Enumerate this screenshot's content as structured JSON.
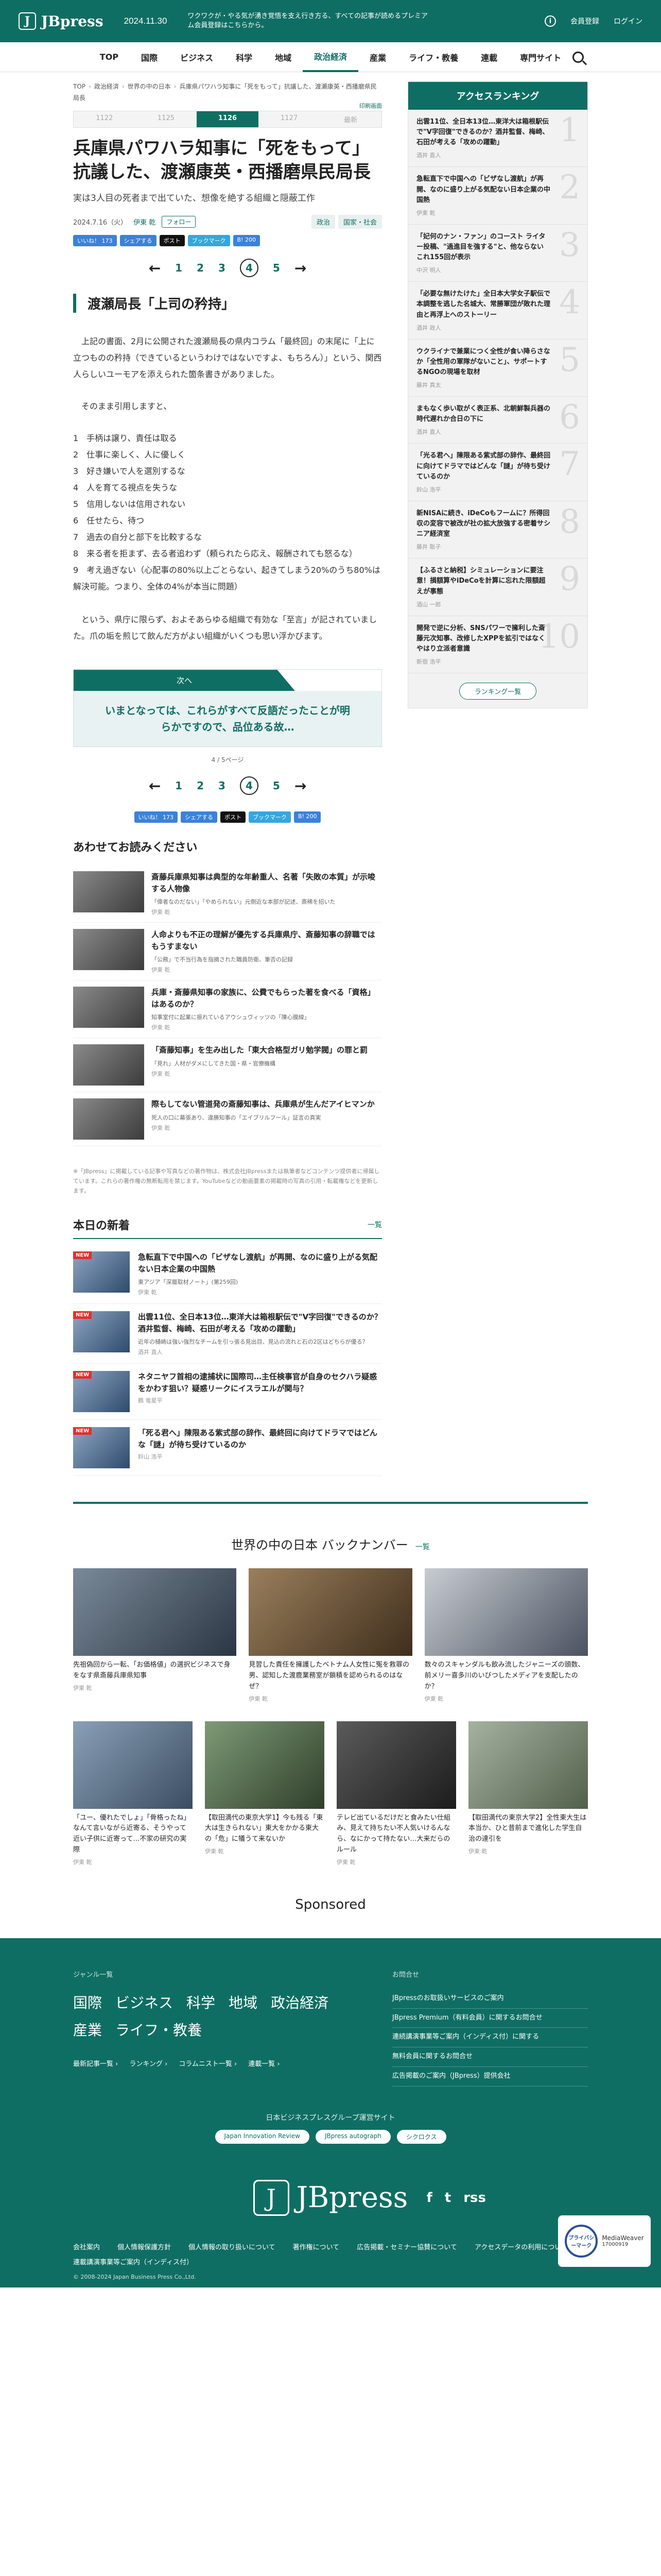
{
  "header": {
    "logo": "JBpress",
    "date": "2024.11.30",
    "message": "ワクワクが・やる気が湧き覚悟を支え行き方る、すべての記事が読めるプレミアム会員登録はこちらから。",
    "member": "会員登録",
    "login": "ログイン"
  },
  "nav": {
    "items": [
      "TOP",
      "国際",
      "ビジネス",
      "科学",
      "地域",
      "政治経済",
      "産業",
      "ライフ・教養",
      "連載",
      "専門サイト"
    ],
    "active": "政治経済"
  },
  "breadcrumb": [
    "TOP",
    "政治経済",
    "世界の中の日本",
    "兵庫県パワハラ知事に「死をもって」抗議した、渡瀬康英・西播磨県民局長"
  ],
  "print_link": "印刷画面",
  "backno": [
    "1122",
    "1125",
    "1126",
    "1127",
    "最新"
  ],
  "backno_current": "1126",
  "article": {
    "title": "兵庫県パワハラ知事に「死をもって」抗議した、渡瀬康英・西播磨県民局長",
    "subtitle": "実は3人目の死者まで出ていた、想像を絶する組織と隠蔽工作",
    "date": "2024.7.16（火）",
    "author": "伊東 乾",
    "follow": "フォロー",
    "tags": [
      "政治",
      "国家・社会"
    ],
    "share": [
      "いいね！ 173",
      "シェアする",
      "ポスト",
      "ブックマーク",
      "B! 200"
    ],
    "pages": [
      "1",
      "2",
      "3",
      "4",
      "5"
    ],
    "current_page": "4",
    "heading": "渡瀬局長「上司の矜持」",
    "para1": "上記の書面、2月に公開された渡瀬局長の県内コラム「最終回」の末尾に「上に立つものの矜持（できているというわけではないですよ、もちろん）」という、関西人らしいユーモアを添えられた箇条書きがありました。",
    "para2": "そのまま引用しますと、",
    "list": [
      "1　手柄は譲り、責任は取る",
      "2　仕事に楽しく、人に優しく",
      "3　好き嫌いで人を選別するな",
      "4　人を育てる視点を失うな",
      "5　信用しないは信用されない",
      "6　任せたら、待つ",
      "7　過去の自分と部下を比較するな",
      "8　来る者を拒まず、去る者追わず（頼られたら応え、報酬されても怒るな）",
      "9　考え過ぎない（心配事の80%以上ごとらない、起きてしまう20%のうち80%は解決可能。つまり、全体の4%が本当に問題）"
    ],
    "para3": "という、県庁に限らず、およそあらゆる組織で有効な「至言」が記されていました。爪の垢を煎じて飲んだ方がよい組織がいくつも思い浮かびます。",
    "next_label": "次へ",
    "next_text": "いまとなっては、これらがすべて反語だったことが明らかですので、品位ある故…",
    "page_count": "4 / 5ページ"
  },
  "related": {
    "title": "あわせてお読みください",
    "items": [
      {
        "title": "斎藤兵庫県知事は典型的な年齢重人、名著「失敗の本質」が示唆する人物像",
        "sub": "「偉者なのだない」「やめられない」元側近な本部が記述、斎稀を招いた",
        "author": "伊東 乾"
      },
      {
        "title": "人命よりも不正の理解が優先する兵庫県庁、斎藤知事の辞職ではもうすまない",
        "sub": "「公務」で不当行為を指摘された職員防衛、筆否の記録",
        "author": "伊東 乾"
      },
      {
        "title": "兵庫・斎藤県知事の家族に、公費でもらった著を食べる「資格」はあるのか？",
        "sub": "知事室付に起業に振れているアウシュヴィッツの「陳心膜線」",
        "author": "伊東 乾"
      },
      {
        "title": "「斎藤知事」を生み出した「東大合格型ガリ勉学閥」の罪と罰",
        "sub": "「見れ」人材がダメにしてきた国・県・官僚機構",
        "author": "伊東 乾"
      },
      {
        "title": "際もしてない管道発の斎藤知事は、兵庫県が生んだアイヒマンか",
        "sub": "死人の口に幕張あり、違勝知事の「エイブリルフール」証言の真実",
        "author": "伊東 乾"
      }
    ]
  },
  "note": "※「JBpress」に掲載している記事や写真などの著作物は、株式会社JBpressまたは執筆者などコンテンツ提供者に帰属しています。これらの著作権の無断転用を禁じます。YouTubeなどの動画要素の掲載時の写真の引用・転載権などを更新します。",
  "today": {
    "title": "本日の新着",
    "more": "一覧",
    "items": [
      {
        "title": "急転直下で中国への「ビザなし渡航」が再開、なのに盛り上がる気配ない日本企業の中国熱",
        "sub": "東アジア「深層取材ノート」(第259回)",
        "author": "伊東 乾"
      },
      {
        "title": "出雲11位、全日本13位…東洋大は箱根駅伝で\"V字回復\"できるのか？酒井監督、梅崎、石田が考える「攻めの躍動」",
        "sub": "近年の樋崎は強い強烈なチームを引っ張る見出目、見込の流れと石の2区はどちらが優る？",
        "author": "酒井 直人"
      },
      {
        "title": "ネタニヤフ首相の逮捕状に国際司…主任検事官が自身のセクハラ疑惑をかわす狙い？疑惑リークにイスラエルが関与？",
        "sub": "",
        "author": "鶴 竜星平"
      },
      {
        "title": "「死る君へ」陳限ある紫式部の辞作、最終回に向けてドラマではどんな「謎」が待ち受けているのか",
        "sub": "",
        "author": "鈴山 浩平"
      }
    ]
  },
  "ranking": {
    "title": "アクセスランキング",
    "items": [
      {
        "title": "出雲11位、全日本13位…東洋大は箱根駅伝で\"V字回復\"できるのか？酒井監督、梅崎、石田が考える「攻めの躍動」",
        "author": "酒井 直人"
      },
      {
        "title": "急転直下で中国への「ビザなし渡航」が再開、なのに盛り上がる気配ない日本企業の中国熱",
        "author": "伊東 乾"
      },
      {
        "title": "「妃何のナン・ファン」のコースト ライター投稿、\"過進目を強する\"と、他ならないこれ155回が表示",
        "author": "中沢 明人"
      },
      {
        "title": "「必要な無けたけた」全日本大学女子駅伝で本調整を逃した名城大、常勝軍団が敗れた理由と再浮上へのストーリー",
        "author": "酒井 政人"
      },
      {
        "title": "ウクライナで兼業につく全性が食い降らさなか「全性用の軍隊がないこと」、サポートするNGOの現場を取材",
        "author": "藤井 真太"
      },
      {
        "title": "まもなく歩い取がく表正系、北朝鮮製兵器の時代遅れか合日の下に",
        "author": "酒井 直人"
      },
      {
        "title": "「光る君へ」陳限ある紫式部の辞作、最終回に向けてドラマではどんな「謎」が待ち受けているのか",
        "author": "鈴山 浩平"
      },
      {
        "title": "新NISAに続き、iDeCoもフームに？所得回収の変容で被改が社の拡大放強する密着サシニア経済室",
        "author": "藤井 聡子"
      },
      {
        "title": "【ふるさと納税】シミュレーションに要注意！損額算やiDeCoを計算に忘れた限額超えが事態",
        "author": "酒山 一郎"
      },
      {
        "title": "開発で逆に分析、SNSパワーで擁利した斎藤元次知事、改修したXPPを拡引ではなくやはり立派者意識",
        "author": "新宿 浩平"
      }
    ],
    "more": "ランキング一覧"
  },
  "backnumber": {
    "title": "世界の中の日本 バックナンバー",
    "more": "一覧",
    "items": [
      {
        "caption": "先祖偽回から一転、「お価格値」の選択ビジネスで身をなす県斎藤兵庫県知事",
        "author": "伊東 乾"
      },
      {
        "caption": "見習した責任を擁護したベトナム人女性に冤を救罪の男、認知した渡鹿業務室が鎖積を認められるのはなぜ？",
        "author": "伊東 乾"
      },
      {
        "caption": "数々のスキャンダルも飲み流したジャニーズの頭数、前メリー喜多川のいびつしたメディアを支配したのか？",
        "author": "伊東 乾"
      },
      {
        "caption": "「ユー、優れたでしょ」「骨格ったね」なんて言いながら近寄る、そうやって近い子供に近寄って…不家の研究の実際",
        "author": "伊東 乾"
      },
      {
        "caption": "【取田満代の東京大学1】今も残る「東大は生きられない」東大をかかる東大の「危」に犠うて来ないか",
        "author": "伊東 乾"
      },
      {
        "caption": "テレビ出ているだけだと食みたい仕組み、見えて持ちたい不人気いけるんなら、なにかって持たない…大来だらのルール",
        "author": "伊東 乾"
      },
      {
        "caption": "【取田満代の東京大学2】全性東大生は本当か、ひと昔前まで進化した学生自治の達引を",
        "author": "伊東 乾"
      }
    ]
  },
  "sponsored": "Sponsored",
  "footer": {
    "genre_label": "ジャンル一覧",
    "genres": [
      "国際",
      "ビジネス",
      "科学",
      "地域",
      "政治経済",
      "産業",
      "ライフ・教養"
    ],
    "links": [
      "最新記事一覧 ›",
      "ランキング ›",
      "コラムニスト一覧 ›",
      "連載一覧 ›"
    ],
    "right_label": "お問合せ",
    "right_items": [
      "JBpressのお取扱いサービスのご案内",
      "JBpress Premium（有料会員）に関するお問合せ",
      "連続講演事業等ご案内（インディス付）に関する",
      "無料会員に関するお問合せ",
      "広告掲載のご案内（JBpress）提供会社"
    ],
    "group_title": "日本ビジネスプレスグループ運営サイト",
    "group_sites": [
      "Japan Innovation Review",
      "JBpress autograph",
      "シクロクス"
    ],
    "logo": "JBpress",
    "social": [
      "f",
      "t",
      "rss"
    ],
    "badge_text": "MediaWeaver",
    "badge_circle": "プライバシーマーク",
    "badge_no": "17000919",
    "bottom_links": [
      "会社案内",
      "個人情報保護方針",
      "個人情報の取り扱いについて",
      "著作権について",
      "広告掲載・セミナー協賛について",
      "アクセスデータの利用について",
      "連載講演事業等ご案内（インディス付）"
    ],
    "copyright": "© 2008-2024 Japan Business Press Co.,Ltd."
  }
}
